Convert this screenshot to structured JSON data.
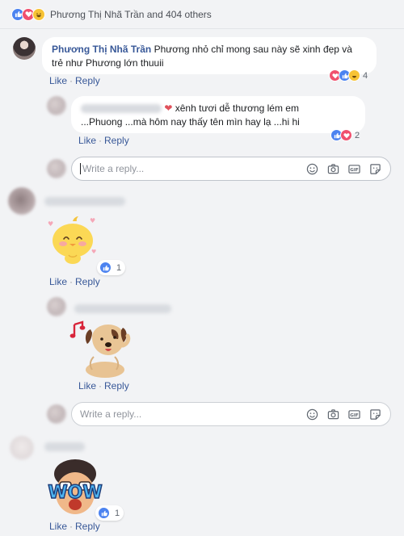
{
  "summary": {
    "text": "Phương Thị Nhã Trần and 404 others"
  },
  "comment1": {
    "author": "Phương Thị Nhã Trần",
    "text_line1": "Phương nhỏ chỉ mong sau này sẽ xinh đẹp và",
    "text_line2": "trẻ như Phương lớn thuuii",
    "like_label": "Like",
    "reply_label": "Reply",
    "reaction_count": "4"
  },
  "reply1": {
    "text_line1": "xênh tươi dễ thương lém em",
    "text_line2": "...Phuong ...mà hôm nay thấy tên mìn hay lạ ...hi hi",
    "like_label": "Like",
    "reply_label": "Reply",
    "reaction_count": "2"
  },
  "reply_box1": {
    "placeholder": "Write a reply..."
  },
  "comment2": {
    "like_label": "Like",
    "reply_label": "Reply",
    "reaction_count": "1"
  },
  "reply2": {
    "like_label": "Like",
    "reply_label": "Reply"
  },
  "reply_box2": {
    "placeholder": "Write a reply..."
  },
  "comment3": {
    "sticker_text": "WOW",
    "like_label": "Like",
    "reply_label": "Reply",
    "reaction_count": "1"
  },
  "icons": {
    "like": "like-icon",
    "love": "love-icon",
    "haha": "haha-icon",
    "emoji": "emoji-icon",
    "camera": "camera-icon",
    "gif": "gif-icon",
    "sticker": "sticker-icon"
  },
  "colors": {
    "link": "#385898",
    "like": "#4c83f0",
    "love": "#f0506e",
    "haha": "#f7c335",
    "background": "#f2f3f5"
  }
}
